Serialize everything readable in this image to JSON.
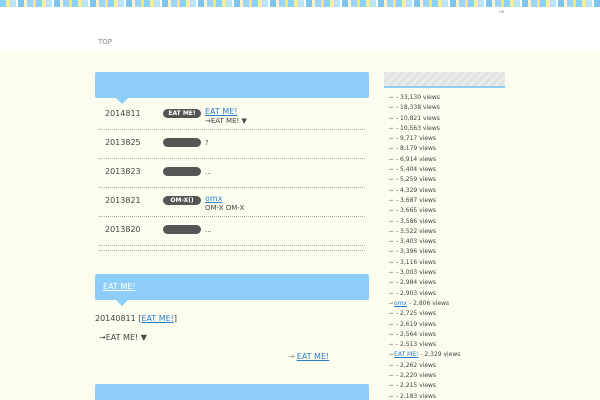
{
  "header": {
    "link_icon": "→",
    "nav_top": "TOP"
  },
  "entries": [
    {
      "date": "2014811",
      "badge": "EAT ME!",
      "title": "EAT ME!",
      "sub": "→EAT ME! ▼"
    },
    {
      "date": "2013825",
      "badge": "",
      "title": "",
      "sub": "?"
    },
    {
      "date": "2013823",
      "badge": "",
      "title": "",
      "sub": "..."
    },
    {
      "date": "2013821",
      "badge": "OM-X()",
      "title": "omx",
      "sub": "OM-X OM-X"
    },
    {
      "date": "2013820",
      "badge": "",
      "title": "",
      "sub": "..."
    }
  ],
  "post": {
    "title": "EAT ME!",
    "date": "20140811",
    "link_text": "EAT ME!",
    "open_bracket": "[",
    "close_bracket": "]",
    "body": "→EAT ME! ▼",
    "more_arrow": "→",
    "more_link": "EAT ME!"
  },
  "ranking": {
    "arrow": "→",
    "items": [
      {
        "label": "",
        "views": "- 33,130 views"
      },
      {
        "label": "",
        "views": "- 18,338 views"
      },
      {
        "label": "",
        "views": "- 10,821 views"
      },
      {
        "label": "",
        "views": "- 10,563 views"
      },
      {
        "label": "",
        "views": "- 9,717 views"
      },
      {
        "label": "",
        "views": "- 8,179 views"
      },
      {
        "label": "",
        "views": "- 6,914 views"
      },
      {
        "label": "",
        "views": "- 5,404 views"
      },
      {
        "label": "",
        "views": "- 5,259 views"
      },
      {
        "label": "",
        "views": "- 4,329 views"
      },
      {
        "label": "",
        "views": "- 3,687 views"
      },
      {
        "label": "",
        "views": "- 3,665 views"
      },
      {
        "label": "",
        "views": "- 3,586 views"
      },
      {
        "label": "",
        "views": "- 3,522 views"
      },
      {
        "label": "",
        "views": "- 3,403 views"
      },
      {
        "label": "",
        "views": "- 3,396 views"
      },
      {
        "label": "",
        "views": "- 3,116 views"
      },
      {
        "label": "",
        "views": "- 3,003 views"
      },
      {
        "label": "",
        "views": "- 2,984 views"
      },
      {
        "label": "",
        "views": "- 2,903 views"
      },
      {
        "label": "omx",
        "views": "- 2,806 views"
      },
      {
        "label": "",
        "views": "- 2,725 views"
      },
      {
        "label": "",
        "views": "- 2,619 views"
      },
      {
        "label": "",
        "views": "- 2,564 views"
      },
      {
        "label": "",
        "views": "- 2,513 views"
      },
      {
        "label": "EAT ME!",
        "views": "- 2,329 views"
      },
      {
        "label": "",
        "views": "- 2,262 views"
      },
      {
        "label": "",
        "views": "- 2,220 views"
      },
      {
        "label": "",
        "views": "- 2,215 views"
      },
      {
        "label": "",
        "views": "- 2,183 views"
      }
    ]
  }
}
